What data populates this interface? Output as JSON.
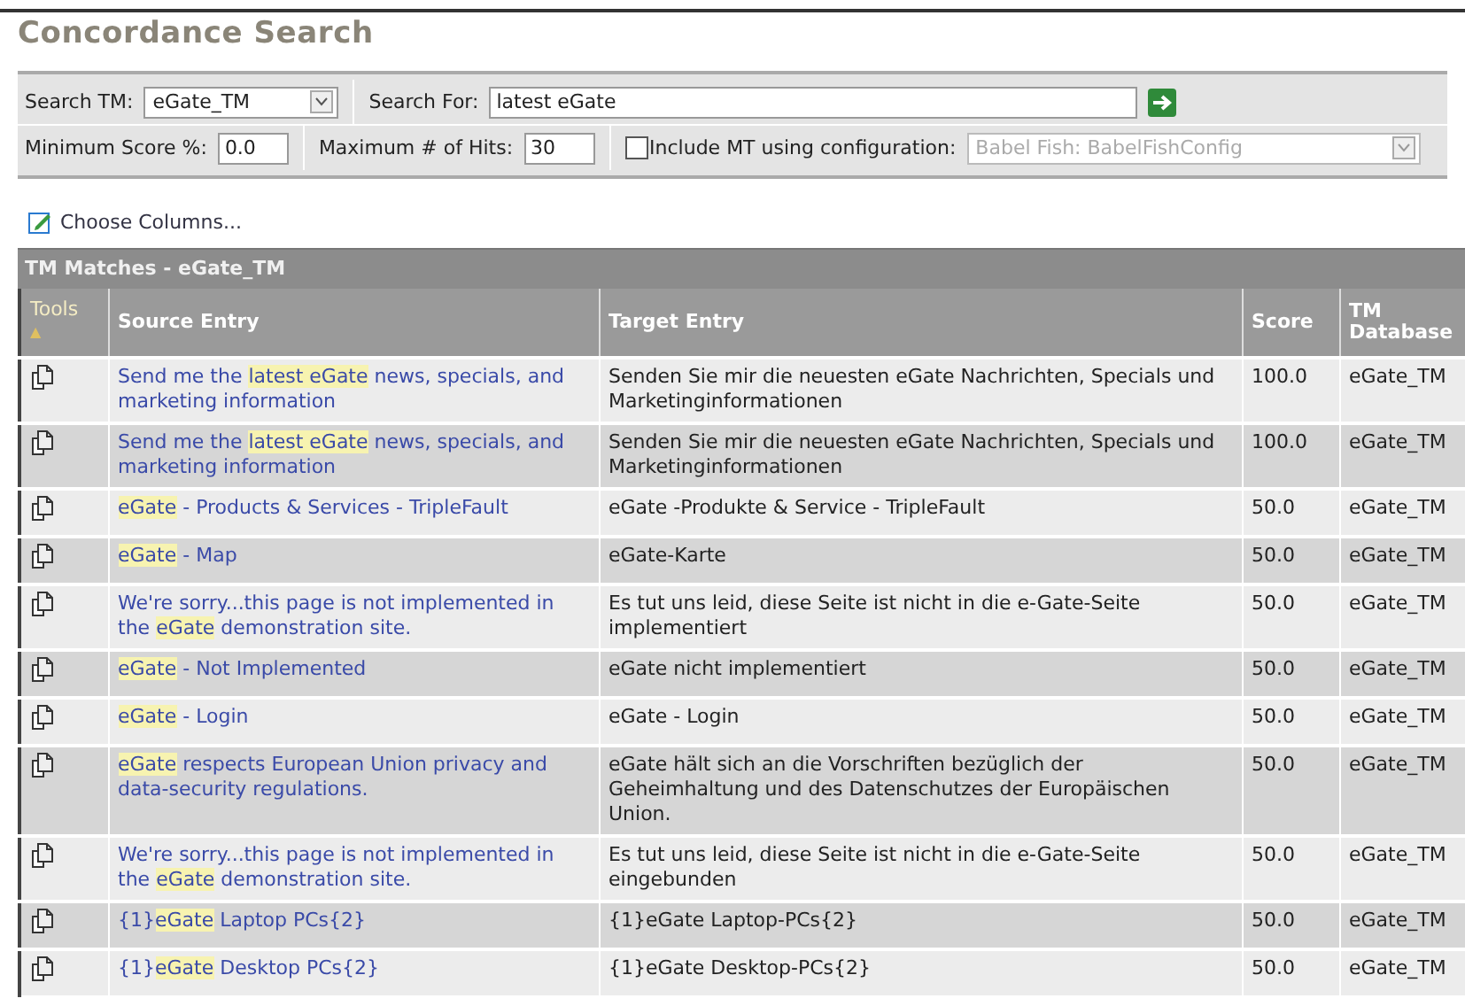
{
  "title": "Concordance Search",
  "search": {
    "tm_label": "Search TM:",
    "tm_value": "eGate_TM",
    "for_label": "Search For:",
    "for_value": "latest eGate",
    "min_label": "Minimum Score %:",
    "min_value": "0.0",
    "hits_label": "Maximum # of Hits:",
    "hits_value": "30",
    "mt_label": "Include MT using configuration:",
    "mt_checked": false,
    "mt_config": "Babel Fish: BabelFishConfig",
    "mt_disabled": true
  },
  "choose_columns": "Choose Columns...",
  "table": {
    "title": "TM Matches - eGate_TM",
    "columns": [
      {
        "label": "Tools",
        "sort_mark": "▲"
      },
      {
        "label": "Source Entry"
      },
      {
        "label": "Target Entry"
      },
      {
        "label": "Score"
      },
      {
        "label": "TM Database"
      }
    ],
    "rows": [
      {
        "source": [
          {
            "text": "Send me the ",
            "highlight": false
          },
          {
            "text": "latest eGate",
            "highlight": true
          },
          {
            "text": " news, specials, and marketing information",
            "highlight": false
          }
        ],
        "target": "Senden Sie mir die neuesten eGate Nachrichten, Specials und Marketinginformationen",
        "score": "100.0",
        "database": "eGate_TM"
      },
      {
        "source": [
          {
            "text": "Send me the ",
            "highlight": false
          },
          {
            "text": "latest eGate",
            "highlight": true
          },
          {
            "text": " news, specials, and marketing information",
            "highlight": false
          }
        ],
        "target": "Senden Sie mir die neuesten eGate Nachrichten, Specials und Marketinginformationen",
        "score": "100.0",
        "database": "eGate_TM"
      },
      {
        "source": [
          {
            "text": "eGate",
            "highlight": true
          },
          {
            "text": " - Products & Services - TripleFault",
            "highlight": false
          }
        ],
        "target": "eGate -Produkte & Service - TripleFault",
        "score": "50.0",
        "database": "eGate_TM"
      },
      {
        "source": [
          {
            "text": "eGate",
            "highlight": true
          },
          {
            "text": " - Map",
            "highlight": false
          }
        ],
        "target": "eGate-Karte",
        "score": "50.0",
        "database": "eGate_TM"
      },
      {
        "source": [
          {
            "text": "We're sorry...this page is not implemented in the ",
            "highlight": false
          },
          {
            "text": "eGate",
            "highlight": true
          },
          {
            "text": " demonstration site.",
            "highlight": false
          }
        ],
        "target": "Es tut uns leid, diese Seite ist nicht in die e-Gate-Seite implementiert",
        "score": "50.0",
        "database": "eGate_TM"
      },
      {
        "source": [
          {
            "text": "eGate",
            "highlight": true
          },
          {
            "text": " - Not Implemented",
            "highlight": false
          }
        ],
        "target": "eGate nicht implementiert",
        "score": "50.0",
        "database": "eGate_TM"
      },
      {
        "source": [
          {
            "text": "eGate",
            "highlight": true
          },
          {
            "text": " - Login",
            "highlight": false
          }
        ],
        "target": "eGate - Login",
        "score": "50.0",
        "database": "eGate_TM"
      },
      {
        "source": [
          {
            "text": "eGate",
            "highlight": true
          },
          {
            "text": " respects European Union privacy and data-security regulations.",
            "highlight": false
          }
        ],
        "target": "eGate hält sich an die Vorschriften bezüglich der Geheimhaltung und des Datenschutzes der Europäischen Union.",
        "score": "50.0",
        "database": "eGate_TM"
      },
      {
        "source": [
          {
            "text": "We're sorry...this page is not implemented in the ",
            "highlight": false
          },
          {
            "text": "eGate",
            "highlight": true
          },
          {
            "text": " demonstration site.",
            "highlight": false
          }
        ],
        "target": "Es tut uns leid, diese Seite ist nicht in die e-Gate-Seite eingebunden",
        "score": "50.0",
        "database": "eGate_TM"
      },
      {
        "source": [
          {
            "text": "{1}",
            "highlight": false
          },
          {
            "text": "eGate",
            "highlight": true
          },
          {
            "text": " Laptop PCs{2}",
            "highlight": false
          }
        ],
        "target": "{1}eGate Laptop-PCs{2}",
        "score": "50.0",
        "database": "eGate_TM"
      },
      {
        "source": [
          {
            "text": "{1}",
            "highlight": false
          },
          {
            "text": "eGate",
            "highlight": true
          },
          {
            "text": " Desktop PCs{2}",
            "highlight": false
          }
        ],
        "target": "{1}eGate Desktop-PCs{2}",
        "score": "50.0",
        "database": "eGate_TM"
      }
    ]
  }
}
